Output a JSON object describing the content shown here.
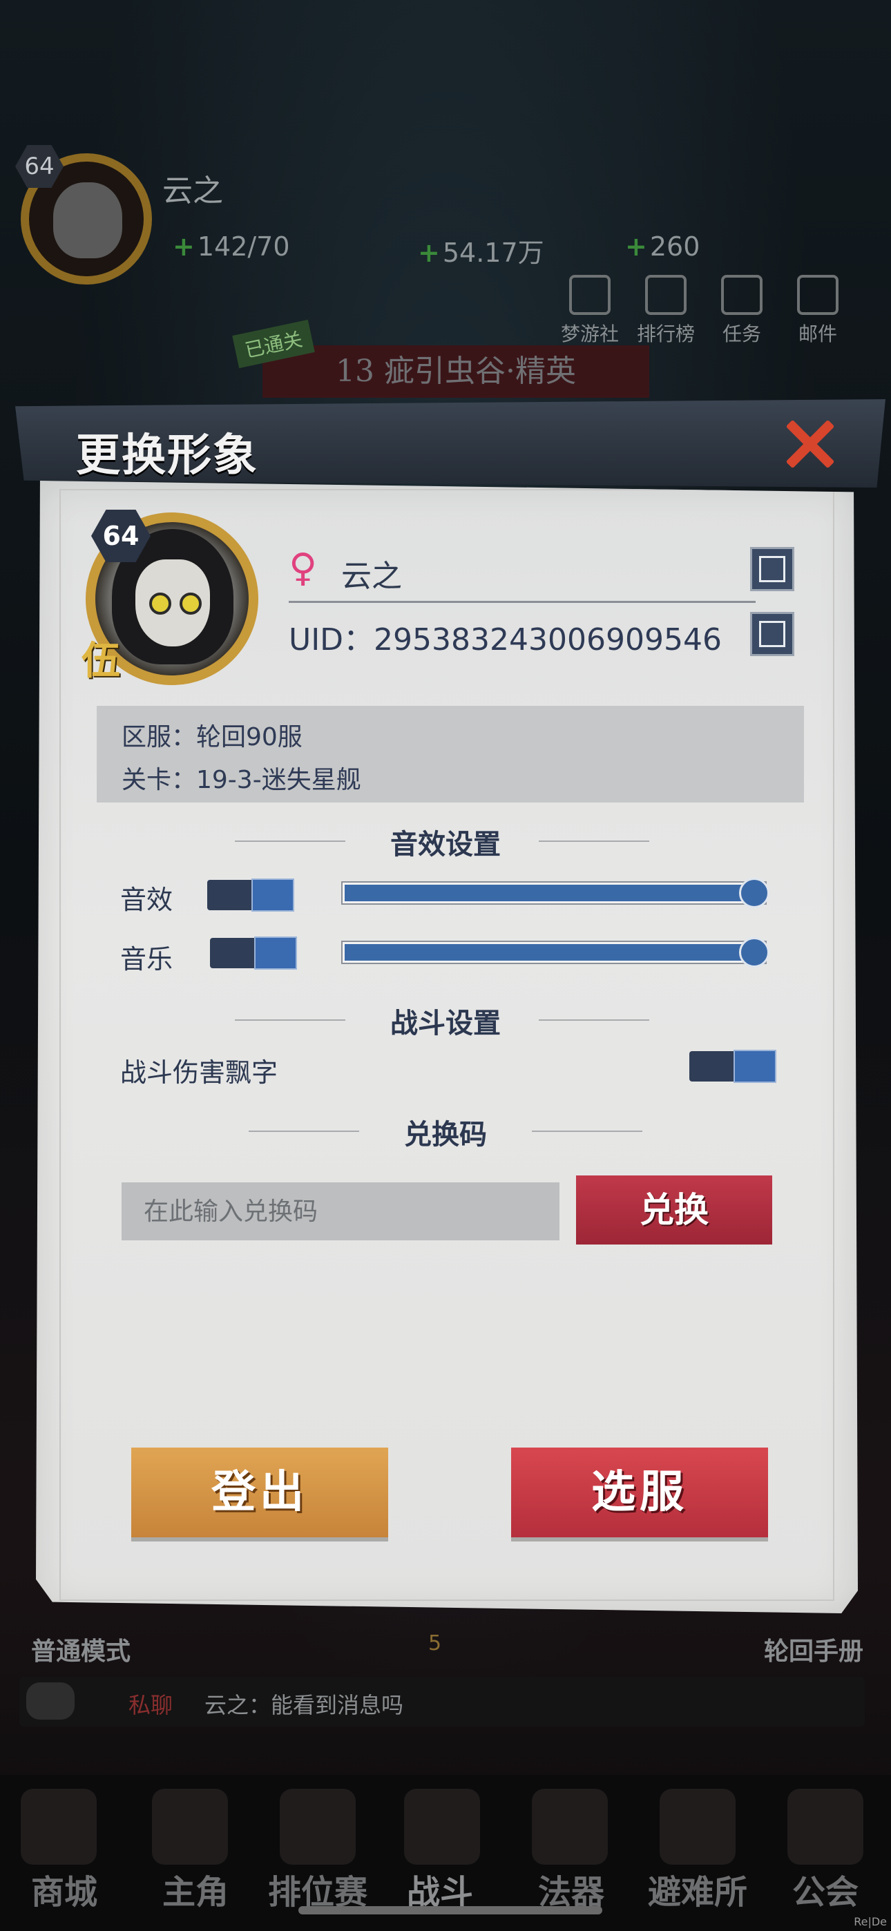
{
  "hud": {
    "level": "64",
    "player_name": "云之",
    "stamina": "142/70",
    "gold": "54.17万",
    "gems": "260",
    "icons": [
      {
        "label": "梦游社",
        "icon": "dreamer-icon"
      },
      {
        "label": "排行榜",
        "icon": "leaderboard-icon"
      },
      {
        "label": "任务",
        "icon": "quest-icon"
      },
      {
        "label": "邮件",
        "icon": "mail-icon"
      }
    ],
    "rank_glyph": "伍",
    "stage_badge": "已通关",
    "stage_name": "13 疵引虫谷·精英"
  },
  "dialog": {
    "title": "更换形象",
    "profile": {
      "level": "64",
      "rank_glyph": "伍",
      "gender_symbol": "♀",
      "name": "云之",
      "uid": "UID：29538324300690​9546"
    },
    "info": {
      "server": "区服：轮回90服",
      "stage": "关卡：19-3-迷失星舰"
    },
    "sound": {
      "title": "音效设置",
      "sfx_label": "音效",
      "music_label": "音乐",
      "sfx_volume": 1.0,
      "music_volume": 1.0
    },
    "battle": {
      "title": "战斗设置",
      "damage_text_label": "战斗伤害飘字"
    },
    "redeem": {
      "title": "兑换码",
      "placeholder": "在此输入兑换码",
      "button": "兑换"
    },
    "logout_button": "登出",
    "select_server_button": "选服"
  },
  "lower": {
    "mode_left": "普通模式",
    "mode_right": "轮回手册",
    "energy_cost": "5",
    "chat_tag": "私聊",
    "chat_message": "云之：能看到消息吗"
  },
  "nav": [
    "商城",
    "主角",
    "排位赛",
    "战斗",
    "法器",
    "避难所",
    "公会"
  ],
  "watermark": "Re|De"
}
